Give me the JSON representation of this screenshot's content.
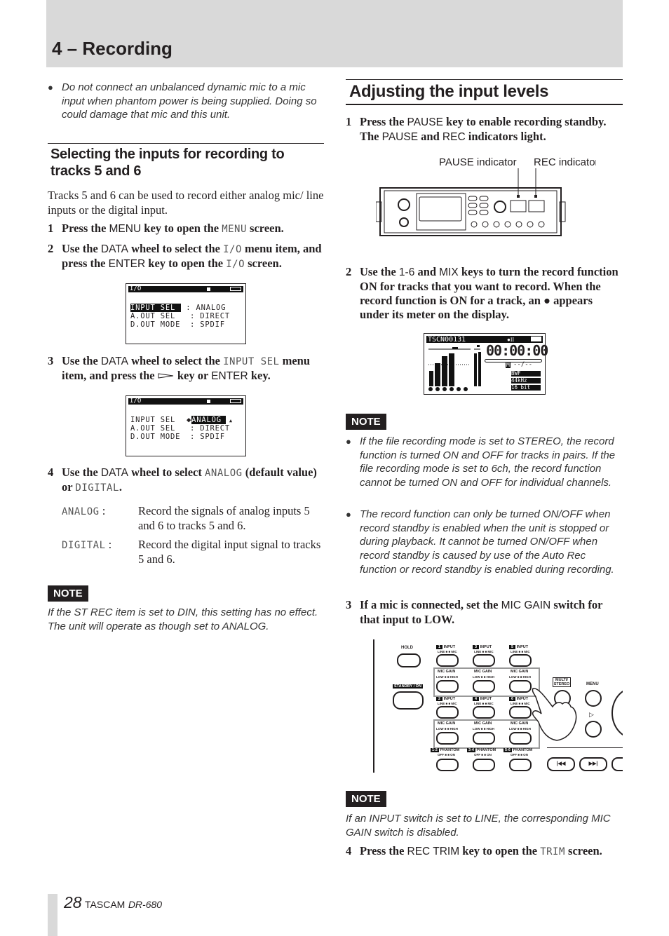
{
  "header": {
    "chapter_title": "4 – Recording"
  },
  "left": {
    "warning_bullet": "Do not connect an unbalanced dynamic mic to a mic input when phantom power is being supplied. Doing so could damage that mic and this unit.",
    "section_title": "Selecting the inputs for recording to tracks 5 and 6",
    "intro": "Tracks 5 and 6 can be used to record either analog mic/ line inputs or the digital input.",
    "step1": {
      "num": "1",
      "a": "Press the ",
      "key": "MENU",
      "b": " key to open the ",
      "code": "MENU",
      "c": " screen."
    },
    "step2": {
      "num": "2",
      "a": "Use the ",
      "key": "DATA",
      "b": " wheel to select the ",
      "code": "I/O",
      "c": " menu item, and press the ",
      "key2": "ENTER",
      "d": " key to open the ",
      "code2": "I/O",
      "e": " screen."
    },
    "lcd1": {
      "title": "I/O",
      "rows": [
        [
          "INPUT SEL",
          ": ANALOG"
        ],
        [
          "A.OUT SEL",
          ": DIRECT"
        ],
        [
          "D.OUT MODE",
          ": SPDIF"
        ]
      ]
    },
    "step3": {
      "num": "3",
      "a": "Use the ",
      "key": "DATA",
      "b": " wheel to select the ",
      "code": "INPUT SEL",
      "c": " menu item, and press the ",
      "d": " key or ",
      "key2": "ENTER",
      "e": " key."
    },
    "lcd2": {
      "title": "I/O",
      "rows": [
        [
          "INPUT SEL",
          "ANALOG"
        ],
        [
          "A.OUT SEL",
          ": DIRECT"
        ],
        [
          "D.OUT MODE",
          ": SPDIF"
        ]
      ]
    },
    "step4": {
      "num": "4",
      "a": "Use the ",
      "key": "DATA",
      "b": " wheel to select ",
      "code": "ANALOG",
      "c": " (default value) or ",
      "code2": "DIGITAL",
      "d": "."
    },
    "definitions": [
      {
        "term": "ANALOG",
        "desc": "Record the signals of analog inputs 5 and 6 to tracks 5 and 6."
      },
      {
        "term": "DIGITAL",
        "desc": "Record the digital input signal to tracks 5 and 6."
      }
    ],
    "note_label": "NOTE",
    "note_text": "If the ST REC item is set to DIN, this setting has no effect. The unit will operate as though set to ANALOG."
  },
  "right": {
    "section_title": "Adjusting the input levels",
    "step1": {
      "num": "1",
      "a": "Press the ",
      "key": "PAUSE",
      "b": " key to enable recording standby. The ",
      "key2": "PAUSE",
      "c": " and ",
      "key3": "REC",
      "d": " indicators light."
    },
    "callout_pause": "PAUSE indicator",
    "callout_rec": "REC indicator",
    "step2": {
      "num": "2",
      "a": "Use the ",
      "key": "1-6",
      "b": " and ",
      "key2": "MIX",
      "c": " keys to turn the record function ON for tracks that you want to record. When the record function is ON for a track, an ● appears under its meter on the display."
    },
    "lcd3": {
      "file": "TSCN00131",
      "time": "00:00:00",
      "marker": "M",
      "counter": "--/--",
      "format": "BWF",
      "rate": "44kHz",
      "bits": "16 bit"
    },
    "note1_label": "NOTE",
    "note1_bullets": [
      "If the file recording mode is set to STEREO, the record function is turned ON and OFF for tracks in pairs. If the file recording mode is set to 6ch, the record function cannot be turned ON and OFF for individual channels.",
      "The record function can only be turned ON/OFF when record standby is enabled when the unit is stopped or during playback. It cannot be turned ON/OFF when record standby is caused by use of the Auto Rec function or record standby is enabled during recording."
    ],
    "step3": {
      "num": "3",
      "a": "If a mic is connected, set the ",
      "key": "MIC GAIN",
      "b": " switch for that input to LOW."
    },
    "panel": {
      "hold": "HOLD",
      "standby": "STANDBY / ON",
      "multi": "MULTI/ STEREO",
      "menu": "MENU",
      "input": "INPUT",
      "line_mic": "LINE ■ ■ MIC",
      "mic_gain": "MIC GAIN",
      "low_high": "LOW ■ ■ HIGH",
      "phantom": "PHANTOM",
      "off_on": "OFF ■ ■ ON",
      "channels_top": [
        "1",
        "3",
        "5"
      ],
      "channels_bottom": [
        "2",
        "4",
        "6"
      ],
      "phantom_pairs": [
        "1-2",
        "3-4",
        "5-6"
      ]
    },
    "note2_label": "NOTE",
    "note2_text": "If an INPUT switch is set to LINE, the corresponding MIC GAIN switch is disabled.",
    "step4": {
      "num": "4",
      "a": "Press the ",
      "key": "REC TRIM",
      "b": " key to open the ",
      "code": "TRIM",
      "c": " screen."
    }
  },
  "footer": {
    "page": "28",
    "brand": "TASCAM",
    "model": "DR-680"
  }
}
